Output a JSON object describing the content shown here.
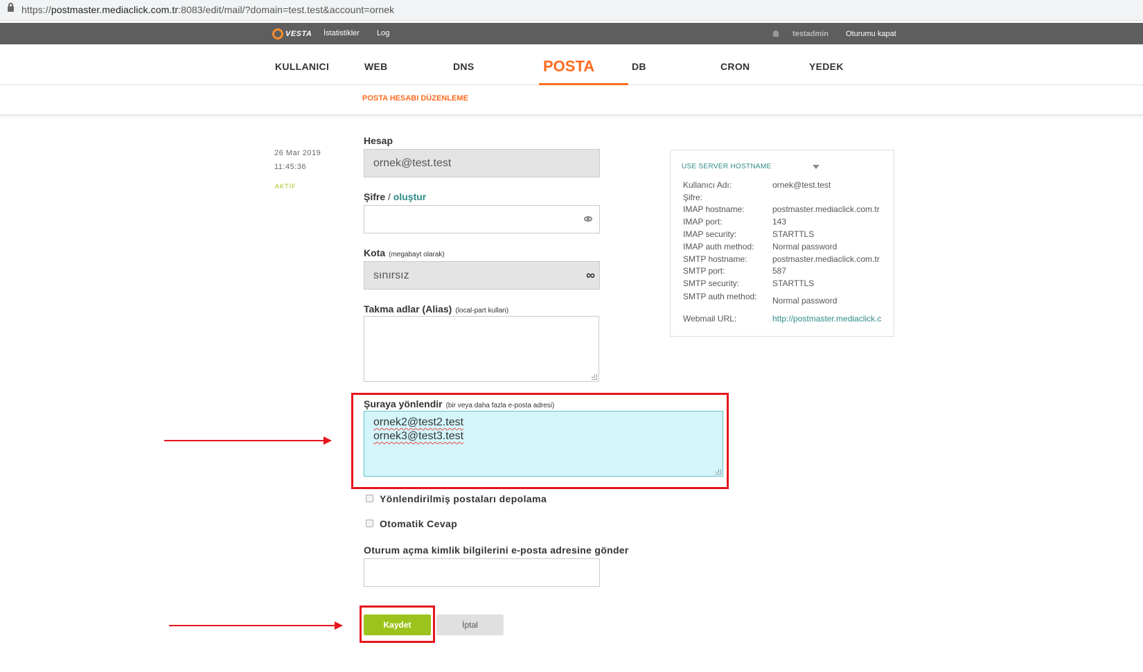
{
  "browser": {
    "url_prefix": "https://",
    "url_host": "postmaster.mediaclick.com.tr",
    "url_path": ":8083/edit/mail/?domain=test.test&account=ornek"
  },
  "topbar": {
    "logo_text": "VESTA",
    "links": [
      "İstatistikler",
      "Log"
    ],
    "user": "testadmin",
    "logout": "Oturumu kapat"
  },
  "mainnav": {
    "tabs": [
      "KULLANICI",
      "WEB",
      "DNS",
      "POSTA",
      "DB",
      "CRON",
      "YEDEK"
    ],
    "active": "POSTA"
  },
  "subnav": {
    "title": "POSTA HESABI DÜZENLEME"
  },
  "meta": {
    "date": "26  Mar  2019",
    "time": "11:45:36",
    "status": "AKTIF"
  },
  "form": {
    "account_label": "Hesap",
    "account_value": "ornek@test.test",
    "password_label": "Şifre",
    "password_sep": " / ",
    "password_generate": "oluştur",
    "password_value": "",
    "quota_label": "Kota",
    "quota_hint": "(megabayt olarak)",
    "quota_value": "sınırsız",
    "quota_unlimited_symbol": "∞",
    "alias_label": "Takma adlar (Alias)",
    "alias_hint": "(local-part kullan)",
    "alias_value": "",
    "forward_label": "Şuraya yönlendir",
    "forward_hint": "(bir veya daha fazla e-posta adresi)",
    "forward_lines": [
      "ornek2@test2.test",
      "ornek3@test3.test"
    ],
    "no_store_label": "Yönlendirilmiş postaları depolama",
    "autoreply_label": "Otomatik Cevap",
    "send_credentials_label": "Oturum açma kimlik bilgilerini e-posta adresine gönder",
    "send_credentials_value": "",
    "save_button": "Kaydet",
    "cancel_button": "İptal"
  },
  "infobox": {
    "header": "USE SERVER HOSTNAME",
    "rows": [
      {
        "label": "Kullanıcı Adı:",
        "value": "ornek@test.test"
      },
      {
        "label": "Şifre:",
        "value": ""
      },
      {
        "label": "IMAP hostname:",
        "value": "postmaster.mediaclick.com.tr"
      },
      {
        "label": "IMAP port:",
        "value": "143"
      },
      {
        "label": "IMAP security:",
        "value": "STARTTLS"
      },
      {
        "label": "IMAP auth method:",
        "value": "Normal password"
      },
      {
        "label": "SMTP hostname:",
        "value": "postmaster.mediaclick.com.tr"
      },
      {
        "label": "SMTP port:",
        "value": "587"
      },
      {
        "label": "SMTP security:",
        "value": "STARTTLS"
      },
      {
        "label": "SMTP auth method:",
        "value": "Normal password"
      },
      {
        "label": "Webmail URL:",
        "value": "http://postmaster.mediaclick.c"
      }
    ]
  },
  "colors": {
    "accent": "#ff6b1f",
    "save": "#9cc31c",
    "link": "#2c8a86",
    "highlight": "#e8141b"
  }
}
